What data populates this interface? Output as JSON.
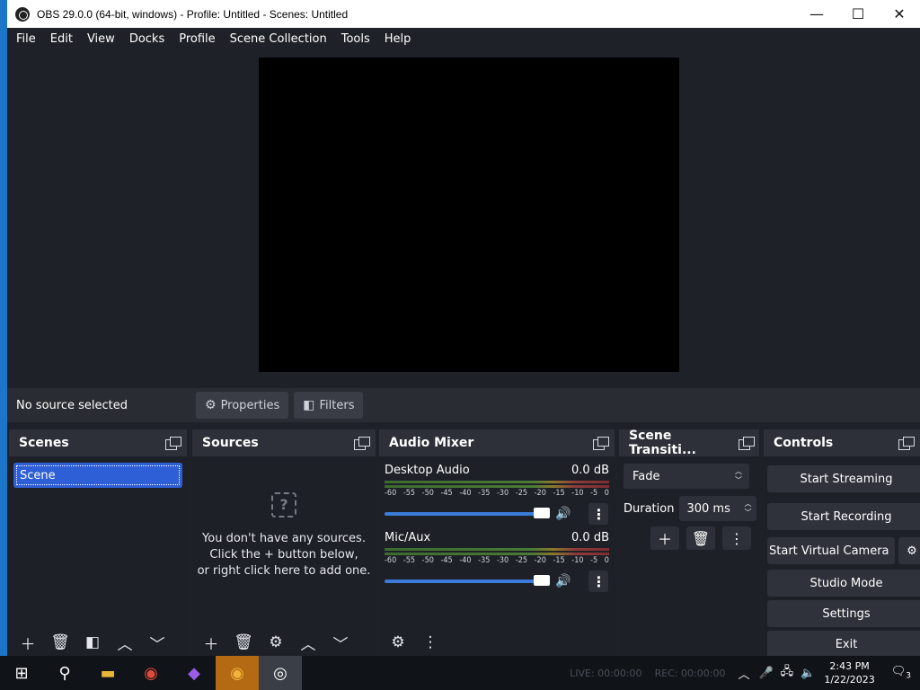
{
  "window": {
    "title": "OBS 29.0.0 (64-bit, windows) - Profile: Untitled - Scenes: Untitled",
    "controls": {
      "minimize": "—",
      "maximize": "☐",
      "close": "✕"
    }
  },
  "menu": [
    "File",
    "Edit",
    "View",
    "Docks",
    "Profile",
    "Scene Collection",
    "Tools",
    "Help"
  ],
  "properties_bar": {
    "status": "No source selected",
    "properties_label": "Properties",
    "filters_label": "Filters"
  },
  "scenes": {
    "title": "Scenes",
    "items": [
      "Scene"
    ]
  },
  "sources": {
    "title": "Sources",
    "empty_line1": "You don't have any sources.",
    "empty_line2": "Click the + button below,",
    "empty_line3": "or right click here to add one."
  },
  "mixer": {
    "title": "Audio Mixer",
    "scale": [
      "-60",
      "-55",
      "-50",
      "-45",
      "-40",
      "-35",
      "-30",
      "-25",
      "-20",
      "-15",
      "-10",
      "-5",
      "0"
    ],
    "channels": [
      {
        "name": "Desktop Audio",
        "level": "0.0 dB",
        "volume": 1.0
      },
      {
        "name": "Mic/Aux",
        "level": "0.0 dB",
        "volume": 1.0
      }
    ]
  },
  "transitions": {
    "title": "Scene Transiti...",
    "selected": "Fade",
    "duration_label": "Duration",
    "duration_value": "300 ms"
  },
  "controls": {
    "title": "Controls",
    "start_streaming": "Start Streaming",
    "start_recording": "Start Recording",
    "start_virtual_camera": "Start Virtual Camera",
    "studio_mode": "Studio Mode",
    "settings": "Settings",
    "exit": "Exit"
  },
  "taskbar": {
    "live": "LIVE: 00:00:00",
    "rec": "REC: 00:00:00",
    "time": "2:43 PM",
    "date": "1/22/2023",
    "notifications": "3"
  }
}
